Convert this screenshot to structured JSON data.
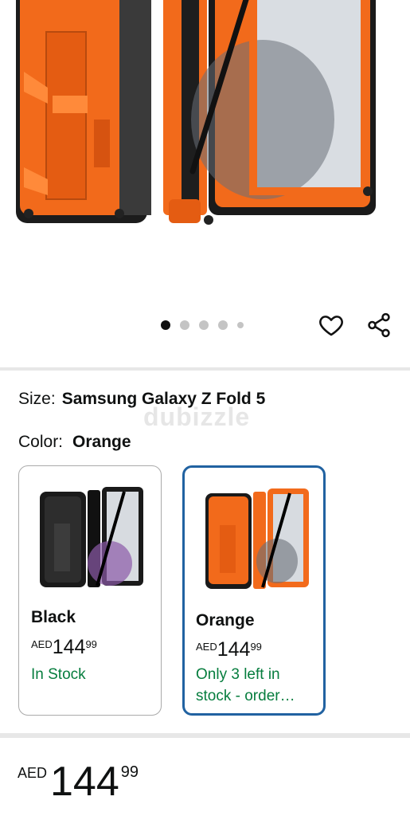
{
  "gallery": {
    "image_alt": "Orange rugged case for Samsung Galaxy Z Fold 5 with stylus",
    "dots_total": 5,
    "dots_active_index": 0
  },
  "actions": {
    "wishlist_icon": "heart-icon",
    "share_icon": "share-icon"
  },
  "watermark": "dubizzle",
  "size": {
    "label": "Size:",
    "value": "Samsung Galaxy Z Fold 5"
  },
  "color": {
    "label": "Color:",
    "value": "Orange"
  },
  "variants": [
    {
      "name": "Black",
      "currency": "AED",
      "price_int": "144",
      "price_frac": "99",
      "stock": "In Stock",
      "selected": false
    },
    {
      "name": "Orange",
      "currency": "AED",
      "price_int": "144",
      "price_frac": "99",
      "stock": "Only 3 left in stock - order…",
      "selected": true
    }
  ],
  "price": {
    "currency": "AED",
    "int": "144",
    "frac": "99"
  },
  "colors": {
    "stock_green": "#067d3e",
    "selected_border": "#2162a1",
    "case_orange": "#f26a1b"
  }
}
